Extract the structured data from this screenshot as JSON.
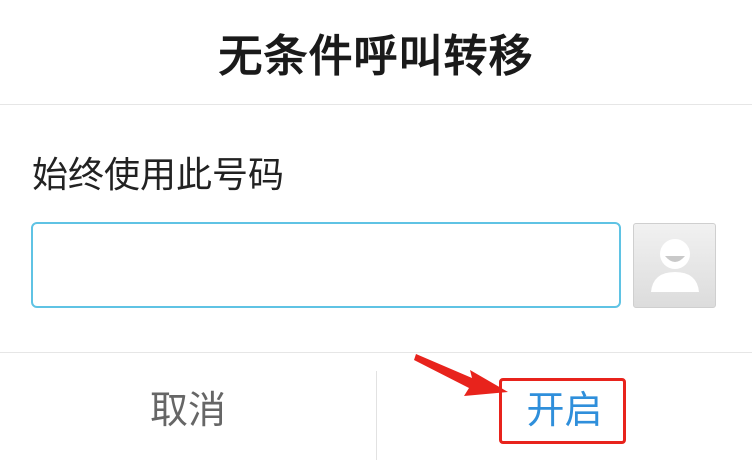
{
  "dialog": {
    "title": "无条件呼叫转移",
    "field_label": "始终使用此号码",
    "number_input": {
      "value": "",
      "placeholder": ""
    },
    "contact_picker_icon": "contact-avatar-icon",
    "buttons": {
      "cancel": "取消",
      "enable": "开启"
    }
  },
  "annotation": {
    "highlight_color": "#e8231c",
    "arrow_icon": "red-arrow-icon"
  },
  "colors": {
    "input_border": "#5fc3e4",
    "enable_text": "#2f8fdb",
    "cancel_text": "#666666"
  }
}
